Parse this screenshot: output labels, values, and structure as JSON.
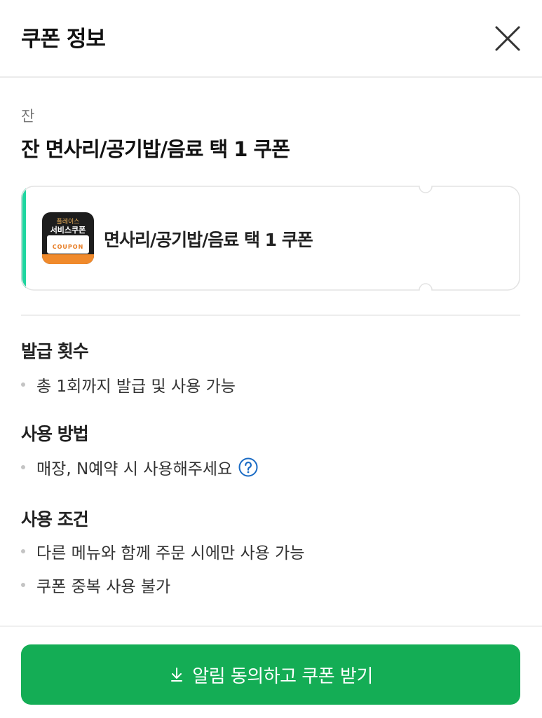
{
  "header": {
    "title": "쿠폰 정보",
    "close_icon": "close-icon"
  },
  "coupon": {
    "store_name": "잔",
    "title": "잔 면사리/공기밥/음료 택 1 쿠폰",
    "card_name": "면사리/공기밥/음료 택 1 쿠폰",
    "thumb": {
      "line1": "플레이스",
      "line2": "서비스쿠폰",
      "line3": "COUPON"
    },
    "accent_color": "#1ed6a0"
  },
  "sections": [
    {
      "title": "발급 횟수",
      "items": [
        "총 1회까지 발급 및 사용 가능"
      ]
    },
    {
      "title": "사용 방법",
      "items": [
        "매장, N예약 시 사용해주세요"
      ],
      "help_icon": "question-circle-icon"
    },
    {
      "title": "사용 조건",
      "items": [
        "다른 메뉴와 함께 주문 시에만 사용 가능",
        "쿠폰 중복 사용 불가"
      ]
    }
  ],
  "cta": {
    "label": "알림 동의하고 쿠폰 받기",
    "icon": "download-icon",
    "color": "#14ad55"
  }
}
